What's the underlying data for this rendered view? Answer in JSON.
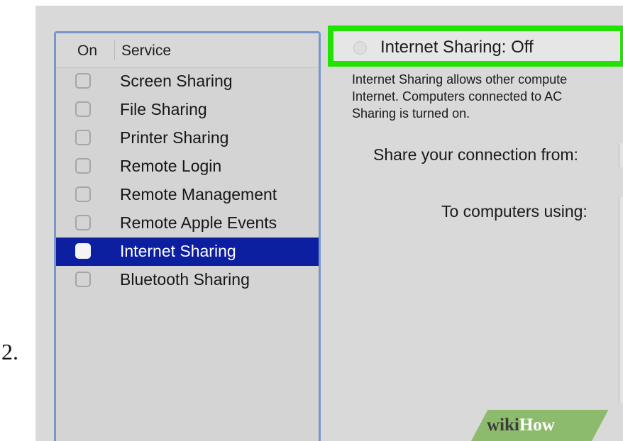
{
  "step_number": "2.",
  "services_list": {
    "header_on": "On",
    "header_service": "Service",
    "items": [
      {
        "label": "Screen Sharing",
        "checked": false,
        "selected": false
      },
      {
        "label": "File Sharing",
        "checked": false,
        "selected": false
      },
      {
        "label": "Printer Sharing",
        "checked": false,
        "selected": false
      },
      {
        "label": "Remote Login",
        "checked": false,
        "selected": false
      },
      {
        "label": "Remote Management",
        "checked": false,
        "selected": false
      },
      {
        "label": "Remote Apple Events",
        "checked": false,
        "selected": false
      },
      {
        "label": "Internet Sharing",
        "checked": false,
        "selected": true
      },
      {
        "label": "Bluetooth Sharing",
        "checked": false,
        "selected": false
      }
    ]
  },
  "detail": {
    "status": "Internet Sharing: Off",
    "status_highlight_color": "#22e300",
    "description_lines": [
      "Internet Sharing allows other compute",
      "Internet. Computers connected to AC",
      "Sharing is turned on."
    ],
    "share_from_label": "Share your connection from:",
    "to_computers_label": "To computers using:"
  },
  "colors": {
    "selection": "#0b1fa0",
    "highlight": "#22e300"
  },
  "watermark": {
    "wiki": "wiki",
    "how": "How"
  }
}
